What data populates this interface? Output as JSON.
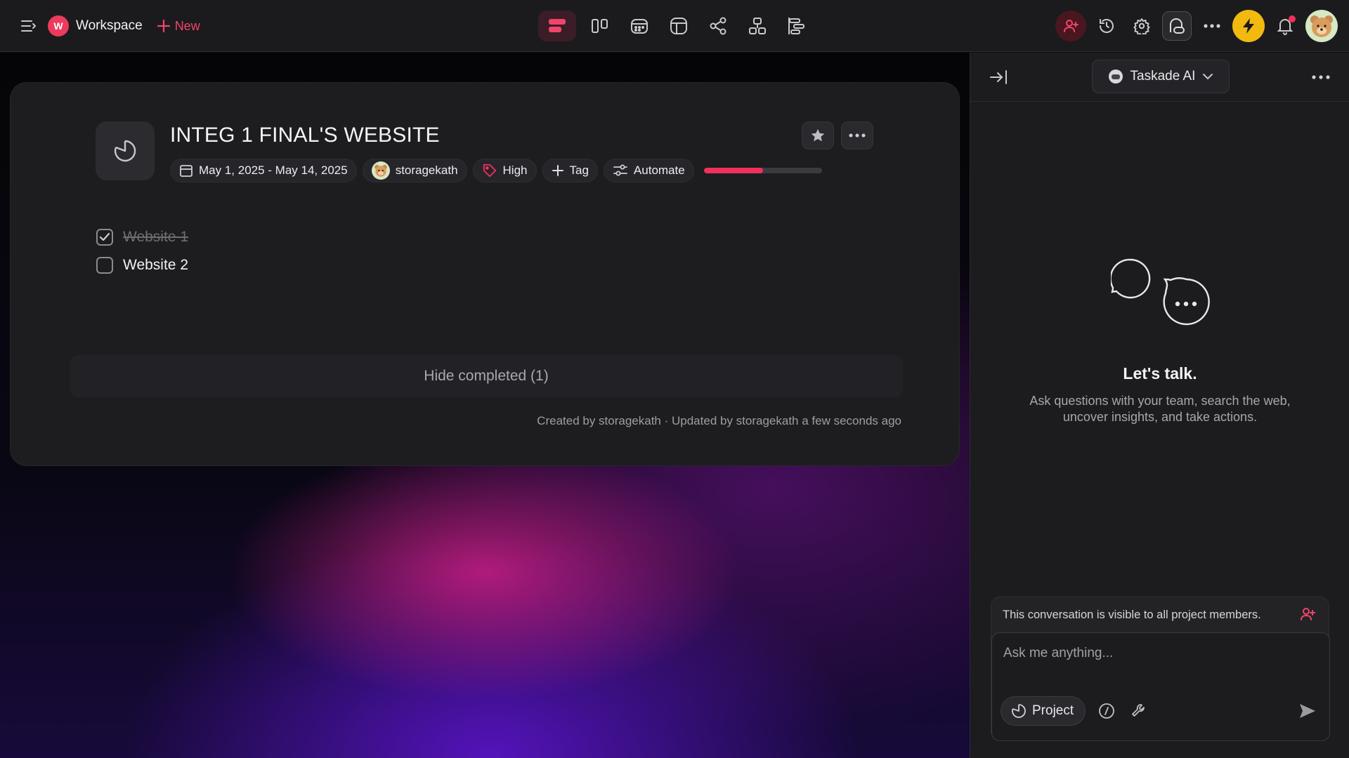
{
  "topbar": {
    "workspace_initial": "W",
    "workspace_name": "Workspace",
    "new_label": "New",
    "views": [
      "list-view",
      "board-view",
      "calendar-view",
      "table-view",
      "mindmap-view",
      "orgchart-view",
      "gantt-view"
    ],
    "active_view": "list-view"
  },
  "project": {
    "title": "INTEG 1 FINAL'S WEBSITE",
    "date_range": "May 1, 2025 - May 14, 2025",
    "assignee": "storagekath",
    "priority": "High",
    "tag_label": "Tag",
    "automate_label": "Automate",
    "progress_fraction": 0.5,
    "tasks": [
      {
        "label": "Website 1",
        "done": true
      },
      {
        "label": "Website 2",
        "done": false
      }
    ],
    "hide_completed_label": "Hide completed (1)",
    "footer": "Created by storagekath · Updated by storagekath a few seconds ago"
  },
  "ai_panel": {
    "selector_label": "Taskade AI",
    "heading": "Let's talk.",
    "subtitle": "Ask questions with your team, search the web, uncover insights, and take actions.",
    "visibility_note": "This conversation is visible to all project members.",
    "input_placeholder": "Ask me anything...",
    "project_chip": "Project"
  },
  "colors": {
    "accent": "#f0305a",
    "bolt": "#f2b90f",
    "panel_bg": "#1c1c1e",
    "card_bg": "#1d1d20"
  }
}
